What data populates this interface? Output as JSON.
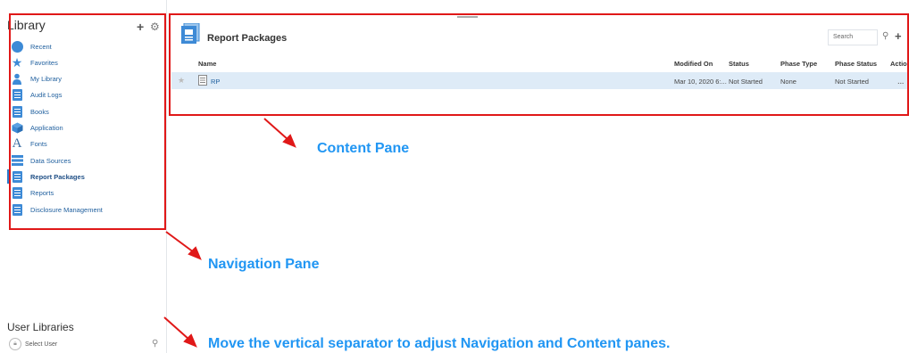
{
  "nav": {
    "title": "Library",
    "items": [
      {
        "label": "Recent",
        "icon": "clock-icon"
      },
      {
        "label": "Favorites",
        "icon": "star-icon"
      },
      {
        "label": "My Library",
        "icon": "user-icon"
      },
      {
        "label": "Audit Logs",
        "icon": "log-icon"
      },
      {
        "label": "Books",
        "icon": "book-icon"
      },
      {
        "label": "Application",
        "icon": "cube-icon"
      },
      {
        "label": "Fonts",
        "icon": "font-icon"
      },
      {
        "label": "Data Sources",
        "icon": "database-icon"
      },
      {
        "label": "Report Packages",
        "icon": "report-package-icon"
      },
      {
        "label": "Reports",
        "icon": "report-icon"
      },
      {
        "label": "Disclosure Management",
        "icon": "disclosure-icon"
      }
    ],
    "user_libraries": {
      "title": "User Libraries",
      "select": "Select User"
    }
  },
  "content": {
    "title": "Report Packages",
    "search_placeholder": "Search",
    "columns": [
      "Name",
      "Modified On",
      "Status",
      "Phase Type",
      "Phase Status",
      "Action"
    ],
    "rows": [
      {
        "name": "RP",
        "modified": "Mar 10, 2020 6:...",
        "status": "Not Started",
        "phase_type": "None",
        "phase_status": "Not Started",
        "action": "…"
      }
    ]
  },
  "callouts": {
    "content": "Content Pane",
    "navigation": "Navigation Pane",
    "separator": "Move the vertical separator to adjust Navigation and Content panes."
  },
  "colors": {
    "annotation_red": "#e01818",
    "annotation_blue": "#2196f3",
    "row_highlight": "#deebf7",
    "icon_blue": "#3d8ad6"
  }
}
